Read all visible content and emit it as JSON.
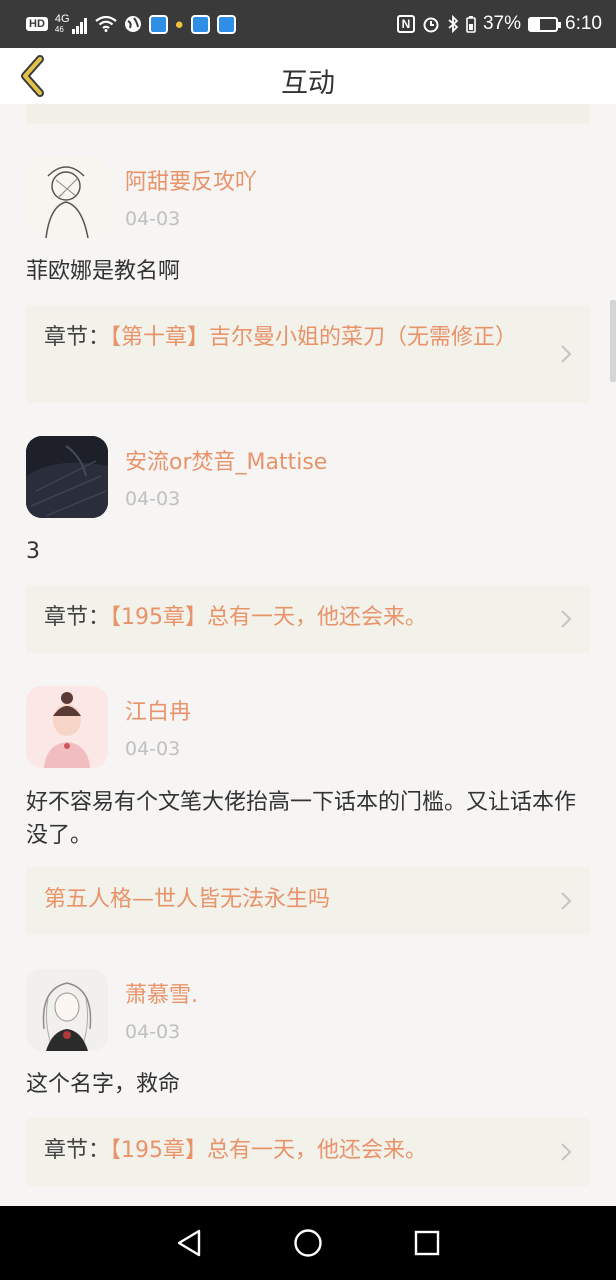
{
  "status_bar": {
    "hd": "HD",
    "signal_top": "4G",
    "signal_bottom": "46",
    "battery_percent": "37%",
    "time": "6:10",
    "battery_level": 0.37
  },
  "header": {
    "title": "互动"
  },
  "posts": [
    {
      "username": "阿甜要反攻吖",
      "date": "04-03",
      "text": "菲欧娜是教名啊",
      "chapter_prefix": "章节：",
      "chapter_title": "【第十章】吉尔曼小姐的菜刀（无需修正）"
    },
    {
      "username": "安流or焚音_Mattise",
      "date": "04-03",
      "text": "3",
      "chapter_prefix": "章节：",
      "chapter_title": "【195章】总有一天，他还会来。"
    },
    {
      "username": "江白冉",
      "date": "04-03",
      "text": "好不容易有个文笔大佬抬高一下话本的门槛。又让话本作没了。",
      "chapter_prefix": "",
      "chapter_title": "第五人格—世人皆无法永生吗"
    },
    {
      "username": "萧慕雪.",
      "date": "04-03",
      "text": "这个名字，救命",
      "chapter_prefix": "章节：",
      "chapter_title": "【195章】总有一天，他还会来。"
    }
  ],
  "colors": {
    "accent": "#e8936a",
    "card_bg": "#f2f1ea",
    "page_bg": "#f6f5f3",
    "back_arrow": "#e0c24a"
  }
}
